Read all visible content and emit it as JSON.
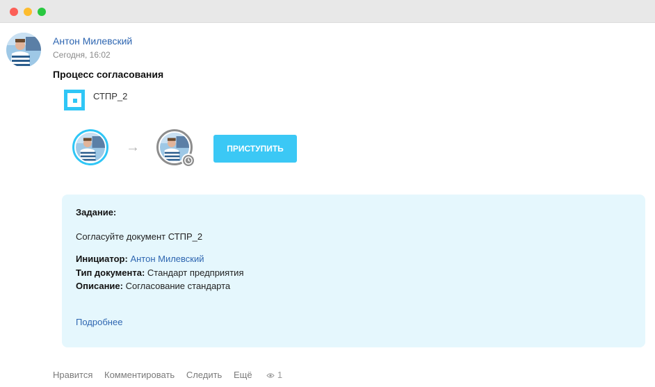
{
  "post": {
    "author": "Антон Милевский",
    "time": "Сегодня, 16:02",
    "title": "Процесс согласования"
  },
  "document": {
    "name": "СТПР_2",
    "accent_color": "#2fc6f6"
  },
  "workflow": {
    "start_button": "ПРИСТУПИТЬ",
    "arrow": "→"
  },
  "task": {
    "heading": "Задание:",
    "text": "Согласуйте документ СТПР_2",
    "initiator_label": "Инициатор:",
    "initiator_value": "Антон Милевский",
    "doctype_label": "Тип документа:",
    "doctype_value": "Стандарт предприятия",
    "description_label": "Описание:",
    "description_value": "Согласование стандарта",
    "more": "Подробнее"
  },
  "footer": {
    "like": "Нравится",
    "comment": "Комментировать",
    "follow": "Следить",
    "more": "Ещё",
    "views": "1"
  }
}
